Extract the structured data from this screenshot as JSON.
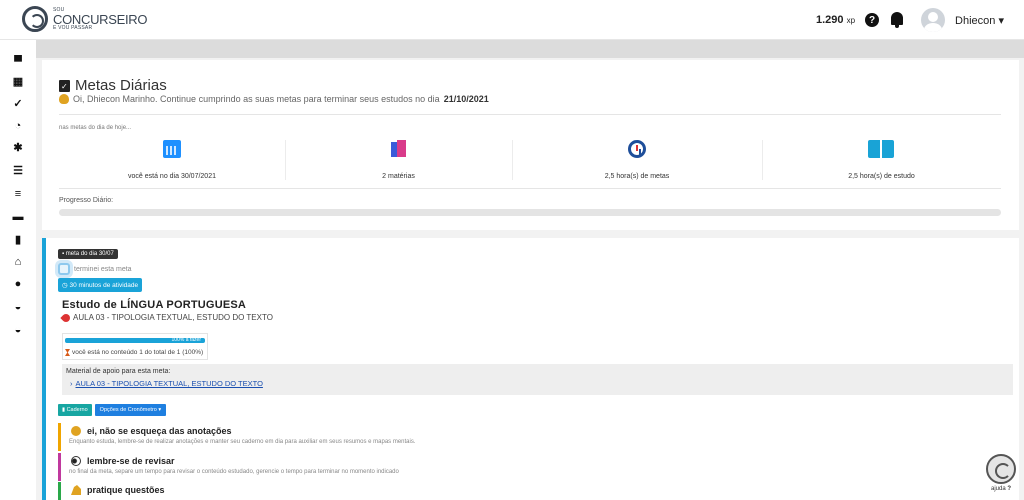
{
  "brand": {
    "small_top": "SOU",
    "name": "CONCURSEIRO",
    "small_bottom": "E VOU PASSAR"
  },
  "header": {
    "xp_value": "1.290",
    "xp_unit": "xp",
    "help_icon": "question-icon",
    "notifications_icon": "bell-icon",
    "user_name": "Dhiecon",
    "chevron": "▾"
  },
  "sidebar": {
    "icons": [
      "coffee-icon",
      "calendar-icon",
      "check-icon",
      "dashboard-icon",
      "gear-icon",
      "list-icon",
      "align-icon",
      "book-icon",
      "file-icon",
      "bank-icon",
      "brain-icon",
      "inbox-icon",
      "inbox-icon"
    ]
  },
  "metas": {
    "title": "Metas Diárias",
    "greeting_prefix": "Oi, Dhiecon Marinho. Continue cumprindo as suas metas para terminar seus estudos no dia",
    "greeting_date": "21/10/2021",
    "today_label": "nas metas do dia de hoje...",
    "stats": [
      {
        "icon": "calendar-icon",
        "label": "você está no dia 30/07/2021"
      },
      {
        "icon": "books-icon",
        "label": "2 matérias"
      },
      {
        "icon": "clock-icon",
        "label": "2,5 hora(s) de metas"
      },
      {
        "icon": "open-book-icon",
        "label": "2,5 hora(s) de estudo"
      }
    ],
    "progress_label": "Progresso Diário:",
    "progress_fraction": 0
  },
  "meta_card": {
    "day_badge": "meta do dia 30/07",
    "checkbox_label": "terminei esta meta",
    "checkbox_checked": false,
    "duration_badge": "30 minutos de atividade",
    "study_title": "Estudo de LÍNGUA PORTUGUESA",
    "study_subtitle": "AULA 03 - TIPOLOGIA TEXTUAL, ESTUDO DO TEXTO",
    "content_progress_label": "100% a fazer",
    "content_progress_fraction": 1,
    "content_text": "você está no conteúdo 1 do total de 1 (100%)",
    "material_label": "Material de apoio para esta meta:",
    "material_link": "AULA 03 - TIPOLOGIA TEXTUAL, ESTUDO DO TEXTO",
    "btn_caderno": "Caderno",
    "btn_cronometro": "Opções de Cronômetro ▾",
    "tips": [
      {
        "icon": "hand-icon",
        "title": "ei, não se esqueça das anotações",
        "text": "Enquanto estuda, lembre-se de realizar anotações e manter seu caderno em dia para auxiliar em seus resumos e mapas mentais.",
        "color": "#f0a500"
      },
      {
        "icon": "eyes-icon",
        "title": "lembre-se de revisar",
        "text": "no final da meta, separe um tempo para revisar o conteúdo estudado, gerencie o tempo para terminar no momento indicado",
        "color": "#c0399e"
      },
      {
        "icon": "muscle-icon",
        "title": "pratique questões",
        "text": "",
        "color": "#2aa84a"
      }
    ]
  },
  "help": {
    "label": "ajuda"
  }
}
